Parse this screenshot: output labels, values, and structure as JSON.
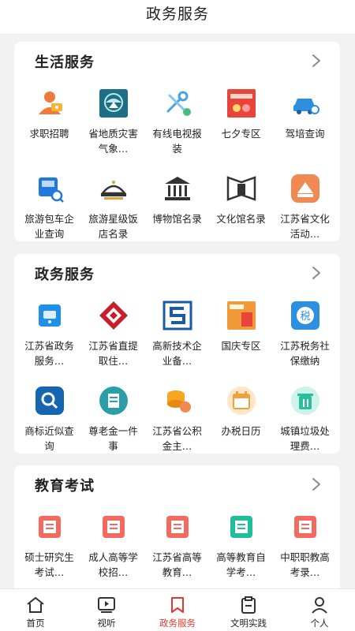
{
  "header": {
    "title": "政务服务"
  },
  "sections": [
    {
      "title": "生活服务",
      "items": [
        {
          "label": "求职招聘",
          "icon": "job-icon"
        },
        {
          "label": "省地质灾害气象…",
          "icon": "weather-disaster-icon"
        },
        {
          "label": "有线电视报装",
          "icon": "tools-icon"
        },
        {
          "label": "七夕专区",
          "icon": "qixi-banner-icon"
        },
        {
          "label": "驾培查询",
          "icon": "car-search-icon"
        },
        {
          "label": "旅游包车企业查询",
          "icon": "bus-search-icon"
        },
        {
          "label": "旅游星级饭店名录",
          "icon": "hotel-icon"
        },
        {
          "label": "博物馆名录",
          "icon": "museum-icon"
        },
        {
          "label": "文化馆名录",
          "icon": "culture-hall-icon"
        },
        {
          "label": "江苏省文化活动…",
          "icon": "culture-activity-icon"
        }
      ]
    },
    {
      "title": "政务服务",
      "items": [
        {
          "label": "江苏省政务服务…",
          "icon": "gov-service-icon"
        },
        {
          "label": "江苏省直提取住…",
          "icon": "housing-fund-icon"
        },
        {
          "label": "高新技术企业备…",
          "icon": "hitech-icon"
        },
        {
          "label": "国庆专区",
          "icon": "national-day-icon"
        },
        {
          "label": "江苏税务社保缴纳",
          "icon": "tax-icon"
        },
        {
          "label": "商标近似查询",
          "icon": "trademark-search-icon"
        },
        {
          "label": "尊老金一件事",
          "icon": "elderly-allowance-icon"
        },
        {
          "label": "江苏省公积金主…",
          "icon": "coins-icon"
        },
        {
          "label": "办税日历",
          "icon": "calendar-icon"
        },
        {
          "label": "城镇垃圾处理费…",
          "icon": "trash-icon"
        }
      ]
    },
    {
      "title": "教育考试",
      "items": [
        {
          "label": "硕士研究生考试…",
          "icon": "exam-book-icon"
        },
        {
          "label": "成人高等学校招…",
          "icon": "exam-book-icon"
        },
        {
          "label": "江苏省高等教育…",
          "icon": "exam-book-icon"
        },
        {
          "label": "高等教育自学考…",
          "icon": "self-study-icon"
        },
        {
          "label": "中职职教高考录…",
          "icon": "exam-book-icon"
        }
      ]
    }
  ],
  "tabbar": [
    {
      "label": "首页",
      "icon": "home-icon"
    },
    {
      "label": "视听",
      "icon": "video-icon"
    },
    {
      "label": "政务服务",
      "icon": "bookmark-icon",
      "active": true
    },
    {
      "label": "文明实践",
      "icon": "clipboard-icon"
    },
    {
      "label": "个人",
      "icon": "person-icon"
    }
  ],
  "colors": {
    "accent": "#e03a2e",
    "background": "#f2f2f2"
  }
}
